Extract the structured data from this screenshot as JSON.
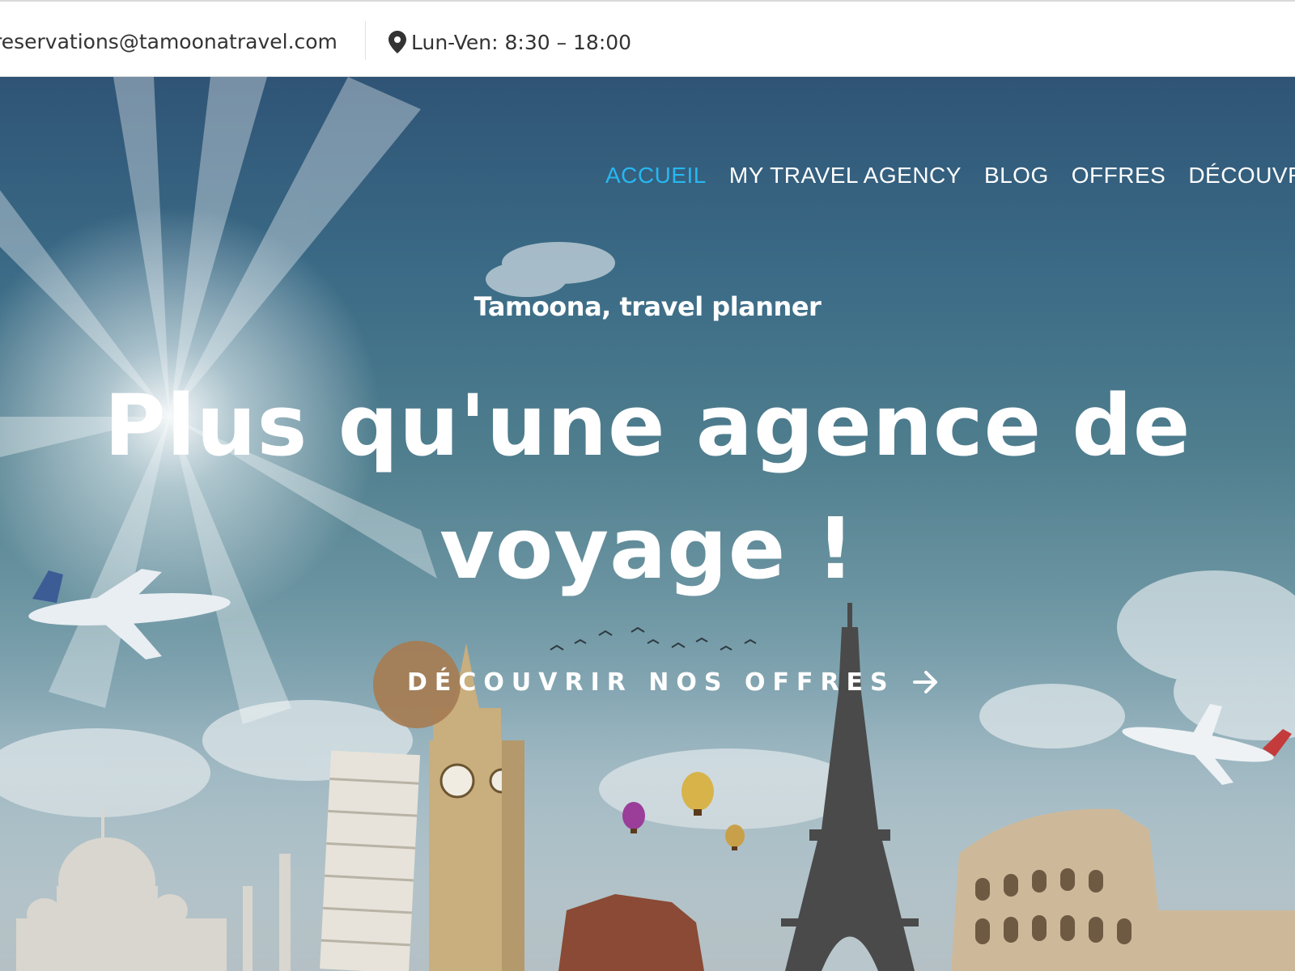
{
  "topbar": {
    "email": "reservations@tamoonatravel.com",
    "hours": "Lun-Ven: 8:30 – 18:00",
    "hours_icon": "map-pin-icon"
  },
  "nav": {
    "items": [
      {
        "label": "ACCUEIL",
        "active": true
      },
      {
        "label": "MY TRAVEL AGENCY",
        "active": false
      },
      {
        "label": "BLOG",
        "active": false
      },
      {
        "label": "OFFRES",
        "active": false
      },
      {
        "label": "DÉCOUVRIR",
        "active": false
      }
    ]
  },
  "hero": {
    "subtitle": "Tamoona, travel planner",
    "title_line1": "Plus qu'une agence de",
    "title_line2": "voyage !",
    "cta_label": "DÉCOUVRIR NOS OFFRES",
    "cta_icon": "arrow-right-icon"
  },
  "colors": {
    "nav_active": "#27b7f0",
    "cta_circle": "#a67c52",
    "text_dark": "#333333"
  }
}
